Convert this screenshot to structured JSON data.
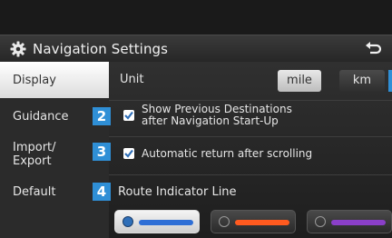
{
  "header": {
    "title": "Navigation Settings",
    "settings_icon": "gear-icon",
    "back_icon": "return-arrow-icon"
  },
  "sidebar": {
    "items": [
      {
        "label": "Display",
        "active": true
      },
      {
        "label": "Guidance",
        "active": false
      },
      {
        "label": "Import/ Export",
        "active": false
      },
      {
        "label": "Default",
        "active": false
      }
    ]
  },
  "main": {
    "unit": {
      "label": "Unit",
      "options": [
        "mile",
        "km"
      ],
      "selected": "mile"
    },
    "show_previous_destinations": {
      "label_line1": "Show Previous Destinations",
      "label_line2": "after Navigation Start-Up",
      "checked": true
    },
    "automatic_return": {
      "label": "Automatic return after scrolling",
      "checked": true
    },
    "route_indicator": {
      "label": "Route Indicator Line",
      "colors": [
        "#2f6fd6",
        "#ff5a1f",
        "#8a3fc8"
      ],
      "selected_index": 0
    }
  },
  "callouts": [
    "2",
    "3",
    "4"
  ],
  "colors": {
    "accent_blue": "#2f8fd6",
    "background": "#1a1a1a"
  }
}
